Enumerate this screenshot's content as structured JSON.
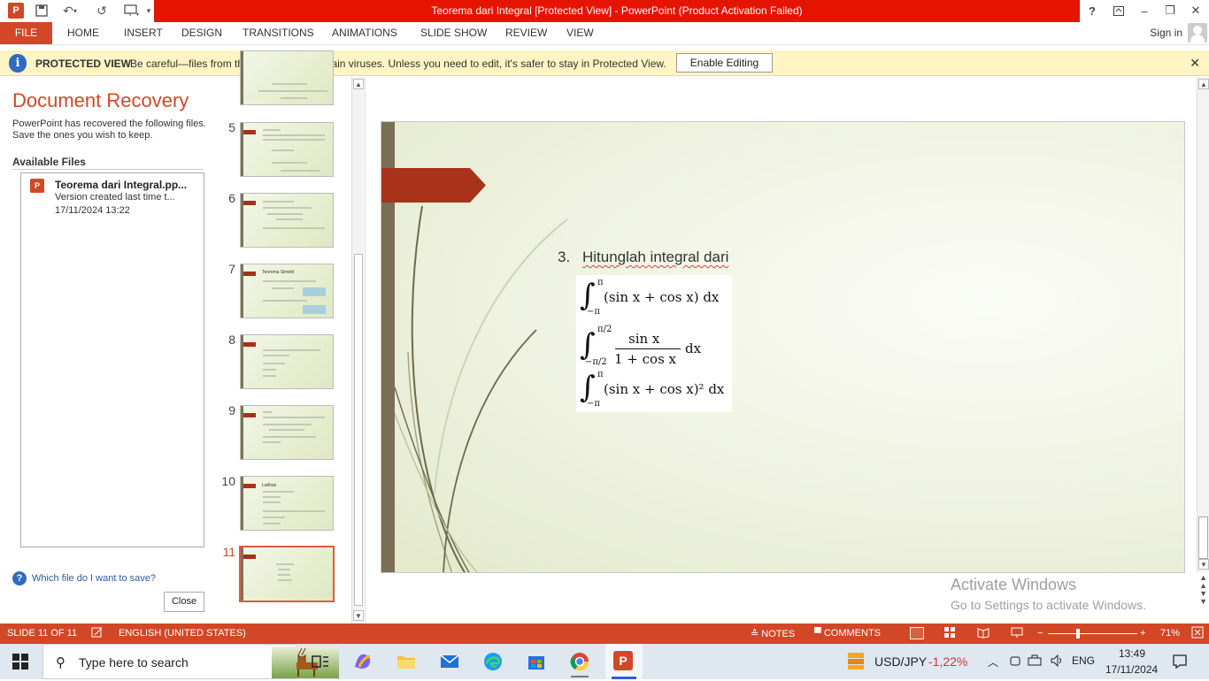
{
  "window": {
    "title": "Teorema dari Integral [Protected View] -  PowerPoint (Product Activation Failed)",
    "help": "?",
    "controls": {
      "minimize": "–",
      "restore": "❐",
      "close": "✕"
    }
  },
  "qat": {
    "app_icon": "P",
    "save": "save-icon",
    "undo": "↶",
    "redo": "↺",
    "present": "present-icon",
    "customize": "▾"
  },
  "ribbon": {
    "tabs": [
      "FILE",
      "HOME",
      "INSERT",
      "DESIGN",
      "TRANSITIONS",
      "ANIMATIONS",
      "SLIDE SHOW",
      "REVIEW",
      "VIEW"
    ],
    "signin": "Sign in"
  },
  "protected": {
    "label": "PROTECTED VIEW",
    "message": "Be careful—files from the Internet can contain viruses. Unless you need to edit, it's safer to stay in Protected View.",
    "button": "Enable Editing",
    "close": "✕",
    "icon": "i"
  },
  "recovery": {
    "title": "Document Recovery",
    "description": "PowerPoint has recovered the following files.  Save the ones you wish to keep.",
    "available_label": "Available Files",
    "file": {
      "icon": "P",
      "name": "Teorema dari Integral.pp...",
      "version": "Version created last time t...",
      "date": "17/11/2024 13:22"
    },
    "help_icon": "?",
    "help_link": "Which file do I want to save?",
    "close": "Close"
  },
  "thumbnails": {
    "numbers": [
      "5",
      "6",
      "7",
      "8",
      "9",
      "10",
      "11"
    ],
    "active": "11",
    "slide7_title": "Teorema Simetri",
    "slide10_title": "Latihan"
  },
  "slide": {
    "item_number": "3.",
    "item_text": "Hitunglah integral dari",
    "formulas": [
      {
        "upper": "π",
        "lower": "−π",
        "body": "(sin x + cos x) dx"
      },
      {
        "upper": "π/2",
        "lower": "−π/2",
        "numerator": "sin x",
        "denominator": "1 + cos x",
        "tail": "dx"
      },
      {
        "upper": "π",
        "lower": "−π",
        "body": "(sin x + cos x)² dx"
      }
    ],
    "integral_sign": "∫"
  },
  "watermark": {
    "line1": "Activate Windows",
    "line2": "Go to Settings to activate Windows."
  },
  "status": {
    "slide": "SLIDE 11 OF 11",
    "language": "ENGLISH (UNITED STATES)",
    "notes": "NOTES",
    "comments": "COMMENTS",
    "zoom": "71%",
    "zoom_minus": "−",
    "zoom_plus": "+"
  },
  "taskbar": {
    "search_placeholder": "Type here to search",
    "ticker": "USD/JPY",
    "ticker_change": "-1,22%",
    "lang": "ENG",
    "time": "13:49",
    "date": "17/11/2024"
  },
  "colors": {
    "accent": "#d24726",
    "titlebar": "#e51400",
    "protbar": "#fff4c3",
    "ticker_down": "#d13438"
  }
}
